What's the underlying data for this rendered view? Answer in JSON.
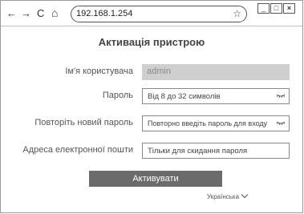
{
  "browser": {
    "nav": {
      "back": "←",
      "forward": "→",
      "reload": "C",
      "home": "⌂"
    },
    "address": "192.168.1.254",
    "bookmark_icon": "star-icon",
    "window_controls": {
      "minimize": "_",
      "maximize": "□",
      "close": "×"
    }
  },
  "page": {
    "title": "Активація пристрою",
    "form": {
      "username": {
        "label": "Ім'я користувача",
        "value": "admin"
      },
      "password": {
        "label": "Пароль",
        "placeholder": "Від 8 до 32 символів"
      },
      "confirm_password": {
        "label": "Повторіть новий пароль",
        "placeholder": "Повторно введіть пароль для входу"
      },
      "email": {
        "label": "Адреса електронної пошти",
        "placeholder": "Тільки для скидання пароля"
      }
    },
    "activate_button": "Активувати",
    "language": "Українська"
  },
  "colors": {
    "button_bg": "#6b6b6b",
    "disabled_field_bg": "#cfcfcf"
  }
}
